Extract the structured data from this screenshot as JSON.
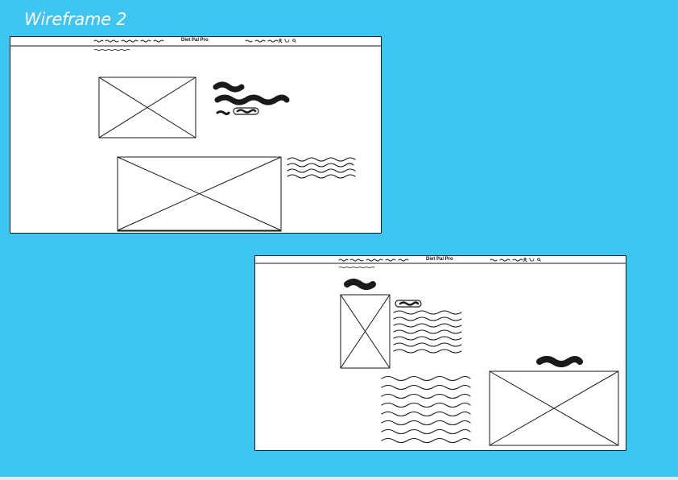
{
  "page": {
    "title": "Wireframe 2",
    "background_color": "#3ec5f1",
    "frame_background": "#ffffff",
    "stroke_color": "#1a1a1a"
  },
  "wireframe_desktop": {
    "brand": "Diet Pal Pro",
    "header_icons": [
      "user-icon",
      "cart-icon",
      "search-icon"
    ]
  },
  "wireframe_article": {
    "brand": "Diet Pal Pro",
    "header_icons": [
      "user-icon",
      "cart-icon",
      "search-icon"
    ]
  }
}
